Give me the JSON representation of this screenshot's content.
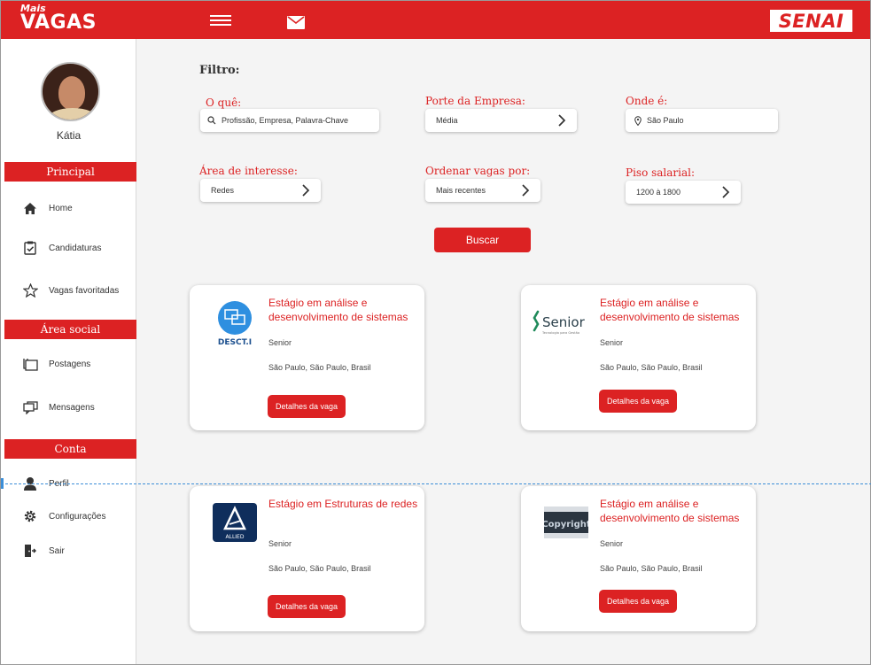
{
  "header": {
    "logo_small": "Mais",
    "logo_big": "VAGAS",
    "brand": "SENAI",
    "icons": [
      "menu-icon",
      "mail-icon"
    ],
    "color_primary": "#dc2223"
  },
  "sidebar": {
    "username": "Kátia",
    "sections": {
      "principal": "Principal",
      "social": "Área social",
      "conta": "Conta"
    },
    "items": [
      {
        "label": "Home",
        "icon": "home-icon"
      },
      {
        "label": "Candidaturas",
        "icon": "clipboard-check-icon"
      },
      {
        "label": "Vagas favoritadas",
        "icon": "star-icon"
      },
      {
        "label": "Postagens",
        "icon": "posts-icon"
      },
      {
        "label": "Mensagens",
        "icon": "chat-icon"
      },
      {
        "label": "Perfil",
        "icon": "user-icon"
      },
      {
        "label": "Configurações",
        "icon": "gear-icon"
      },
      {
        "label": "Sair",
        "icon": "exit-door-icon"
      }
    ]
  },
  "filter": {
    "title": "Filtro:",
    "oque": {
      "label": "O quê:",
      "placeholder": "Profissão, Empresa, Palavra-Chave"
    },
    "porte": {
      "label": "Porte da Empresa:",
      "value": "Média"
    },
    "onde": {
      "label": "Onde é:",
      "value": "São Paulo"
    },
    "area": {
      "label": "Área de interesse:",
      "value": "Redes"
    },
    "ordenar": {
      "label": "Ordenar vagas por:",
      "value": "Mais recentes"
    },
    "piso": {
      "label": "Piso salarial:",
      "value": "1200 à 1800"
    },
    "search_button": "Buscar"
  },
  "jobs": [
    {
      "title": "Estágio em análise e desenvolvimento de sistemas",
      "company": "Senior",
      "location": "São Paulo, São Paulo, Brasil",
      "button": "Detalhes da vaga",
      "logo_text": "DESCT.I"
    },
    {
      "title": "Estágio em análise e desenvolvimento de sistemas",
      "company": "Senior",
      "location": "São Paulo, São Paulo, Brasil",
      "button": "Detalhes da vaga",
      "logo_text": "Senior",
      "logo_tagline": "Tecnologia para Gestão"
    },
    {
      "title": "Estágio em Estruturas de redes",
      "company": "Senior",
      "location": "São Paulo, São Paulo, Brasil",
      "button": "Detalhes da vaga",
      "logo_text": "ALLIED"
    },
    {
      "title": "Estágio em análise e desenvolvimento de sistemas",
      "company": "Senior",
      "location": "São Paulo, São Paulo, Brasil",
      "button": "Detalhes da vaga",
      "logo_text": "Copyright"
    }
  ]
}
